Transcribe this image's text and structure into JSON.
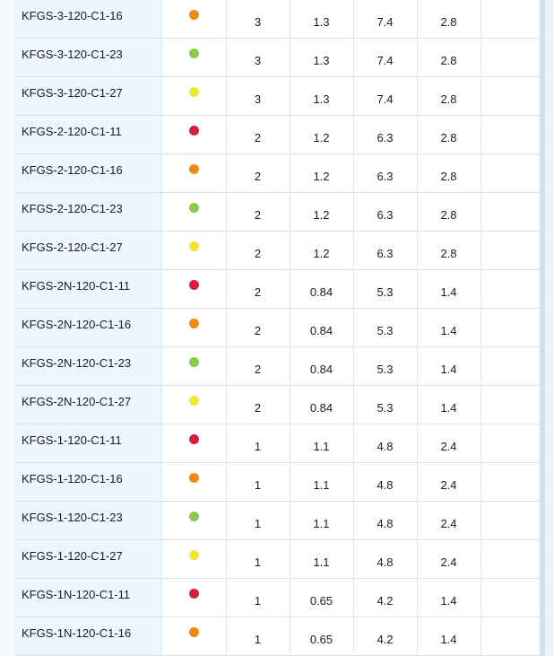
{
  "colors": {
    "red": "#d81f3a",
    "orange": "#f08a12",
    "green": "#8cc84b",
    "yellow": "#f0e638",
    "name_column_background": "#edf6ff",
    "grid_line": "#d9e1e8"
  },
  "rows": [
    {
      "name": "KFGS-3-120-C1-16",
      "status_color": "#f08a12",
      "c1": "3",
      "c2": "1.3",
      "c3": "7.4",
      "c4": "2.8"
    },
    {
      "name": "KFGS-3-120-C1-23",
      "status_color": "#8cc84b",
      "c1": "3",
      "c2": "1.3",
      "c3": "7.4",
      "c4": "2.8"
    },
    {
      "name": "KFGS-3-120-C1-27",
      "status_color": "#f0e638",
      "c1": "3",
      "c2": "1.3",
      "c3": "7.4",
      "c4": "2.8"
    },
    {
      "name": "KFGS-2-120-C1-11",
      "status_color": "#d81f3a",
      "c1": "2",
      "c2": "1.2",
      "c3": "6.3",
      "c4": "2.8"
    },
    {
      "name": "KFGS-2-120-C1-16",
      "status_color": "#f08a12",
      "c1": "2",
      "c2": "1.2",
      "c3": "6.3",
      "c4": "2.8"
    },
    {
      "name": "KFGS-2-120-C1-23",
      "status_color": "#8cc84b",
      "c1": "2",
      "c2": "1.2",
      "c3": "6.3",
      "c4": "2.8"
    },
    {
      "name": "KFGS-2-120-C1-27",
      "status_color": "#f0e638",
      "c1": "2",
      "c2": "1.2",
      "c3": "6.3",
      "c4": "2.8"
    },
    {
      "name": "KFGS-2N-120-C1-11",
      "status_color": "#d81f3a",
      "c1": "2",
      "c2": "0.84",
      "c3": "5.3",
      "c4": "1.4"
    },
    {
      "name": "KFGS-2N-120-C1-16",
      "status_color": "#f08a12",
      "c1": "2",
      "c2": "0.84",
      "c3": "5.3",
      "c4": "1.4"
    },
    {
      "name": "KFGS-2N-120-C1-23",
      "status_color": "#8cc84b",
      "c1": "2",
      "c2": "0.84",
      "c3": "5.3",
      "c4": "1.4"
    },
    {
      "name": "KFGS-2N-120-C1-27",
      "status_color": "#f0e638",
      "c1": "2",
      "c2": "0.84",
      "c3": "5.3",
      "c4": "1.4"
    },
    {
      "name": "KFGS-1-120-C1-11",
      "status_color": "#d81f3a",
      "c1": "1",
      "c2": "1.1",
      "c3": "4.8",
      "c4": "2.4"
    },
    {
      "name": "KFGS-1-120-C1-16",
      "status_color": "#f08a12",
      "c1": "1",
      "c2": "1.1",
      "c3": "4.8",
      "c4": "2.4"
    },
    {
      "name": "KFGS-1-120-C1-23",
      "status_color": "#8cc84b",
      "c1": "1",
      "c2": "1.1",
      "c3": "4.8",
      "c4": "2.4"
    },
    {
      "name": "KFGS-1-120-C1-27",
      "status_color": "#f0e638",
      "c1": "1",
      "c2": "1.1",
      "c3": "4.8",
      "c4": "2.4"
    },
    {
      "name": "KFGS-1N-120-C1-11",
      "status_color": "#d81f3a",
      "c1": "1",
      "c2": "0.65",
      "c3": "4.2",
      "c4": "1.4"
    },
    {
      "name": "KFGS-1N-120-C1-16",
      "status_color": "#f08a12",
      "c1": "1",
      "c2": "0.65",
      "c3": "4.2",
      "c4": "1.4"
    }
  ]
}
